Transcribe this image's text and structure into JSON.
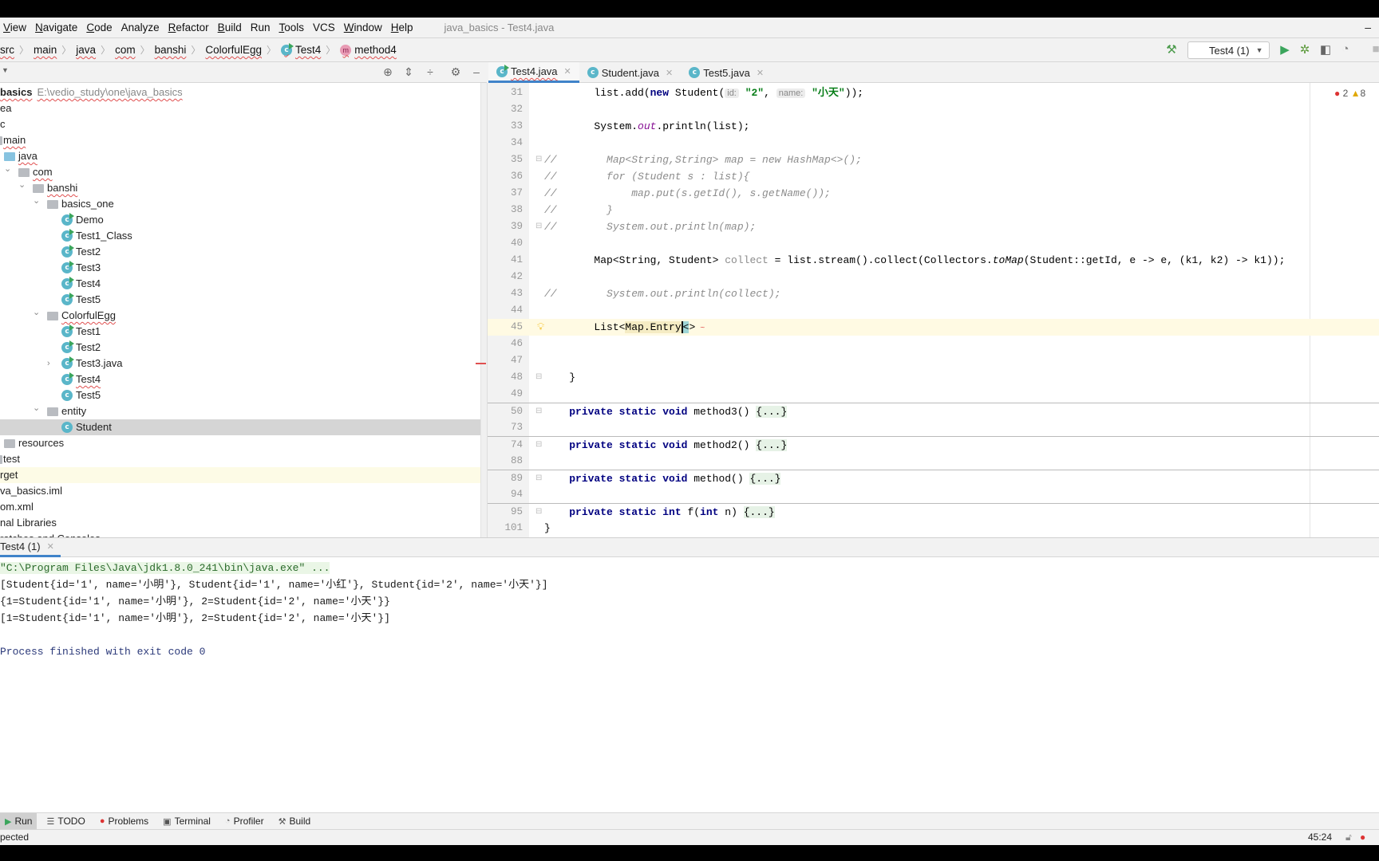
{
  "menu": {
    "items": [
      {
        "label": "View",
        "u": "V"
      },
      {
        "label": "Navigate",
        "u": "N"
      },
      {
        "label": "Code",
        "u": "C"
      },
      {
        "label": "Analyze",
        "u": ""
      },
      {
        "label": "Refactor",
        "u": "R"
      },
      {
        "label": "Build",
        "u": "B"
      },
      {
        "label": "Run",
        "u": ""
      },
      {
        "label": "Tools",
        "u": "T"
      },
      {
        "label": "VCS",
        "u": ""
      },
      {
        "label": "Window",
        "u": "W"
      },
      {
        "label": "Help",
        "u": "H"
      }
    ],
    "window_title": "java_basics - Test4.java",
    "minimize": "–"
  },
  "breadcrumb": [
    "src",
    "main",
    "java",
    "com",
    "banshi",
    "ColorfulEgg",
    "Test4",
    "method4"
  ],
  "toolbar": {
    "run_config": "Test4 (1)"
  },
  "project": {
    "rows": [
      {
        "label": "basics",
        "path": "E:\\vedio_study\\one\\java_basics",
        "depth": 0,
        "bold": true,
        "wavy": true
      },
      {
        "label": "ea",
        "depth": 0
      },
      {
        "label": "c",
        "depth": 0
      },
      {
        "label": "main",
        "depth": 0,
        "wavy": true,
        "stub": true
      },
      {
        "label": "java",
        "depth": 1,
        "icon": "src",
        "wavy": true
      },
      {
        "label": "com",
        "depth": 2,
        "icon": "package",
        "chev": "open",
        "wavy": true
      },
      {
        "label": "banshi",
        "depth": 3,
        "icon": "package",
        "chev": "open",
        "wavy": true
      },
      {
        "label": "basics_one",
        "depth": 4,
        "icon": "package",
        "chev": "open"
      },
      {
        "label": "Demo",
        "depth": 5,
        "icon": "class-run"
      },
      {
        "label": "Test1_Class",
        "depth": 5,
        "icon": "class-run"
      },
      {
        "label": "Test2",
        "depth": 5,
        "icon": "class-run"
      },
      {
        "label": "Test3",
        "depth": 5,
        "icon": "class-run"
      },
      {
        "label": "Test4",
        "depth": 5,
        "icon": "class-run"
      },
      {
        "label": "Test5",
        "depth": 5,
        "icon": "class-run"
      },
      {
        "label": "ColorfulEgg",
        "depth": 4,
        "icon": "package",
        "chev": "open",
        "wavy": true
      },
      {
        "label": "Test1",
        "depth": 5,
        "icon": "class-run"
      },
      {
        "label": "Test2",
        "depth": 5,
        "icon": "class-run"
      },
      {
        "label": "Test3.java",
        "depth": 5,
        "icon": "class-run",
        "chev": "closed"
      },
      {
        "label": "Test4",
        "depth": 5,
        "icon": "class-run",
        "wavy": true
      },
      {
        "label": "Test5",
        "depth": 5,
        "icon": "class"
      },
      {
        "label": "entity",
        "depth": 4,
        "icon": "package",
        "chev": "open"
      },
      {
        "label": "Student",
        "depth": 5,
        "icon": "class",
        "selected": true
      },
      {
        "label": "resources",
        "depth": 1,
        "icon": "resources"
      },
      {
        "label": "test",
        "depth": 0,
        "stub": true
      },
      {
        "label": "rget",
        "depth": 0,
        "highlight": true
      },
      {
        "label": "va_basics.iml",
        "depth": 0
      },
      {
        "label": "om.xml",
        "depth": 0
      },
      {
        "label": "nal Libraries",
        "depth": 0
      },
      {
        "label": "ratches and Consoles",
        "depth": 0
      }
    ]
  },
  "editor": {
    "tabs": [
      {
        "label": "Test4.java",
        "active": true,
        "icon": "class-run",
        "wavy": true
      },
      {
        "label": "Student.java",
        "icon": "class"
      },
      {
        "label": "Test5.java",
        "icon": "class"
      }
    ],
    "errors": "2",
    "warnings": "8",
    "lines": [
      {
        "n": "31",
        "t": [
          [
            "        list.add(",
            ""
          ],
          [
            "new",
            "kw"
          ],
          [
            " Student(",
            ""
          ],
          [
            "id:",
            "hint"
          ],
          [
            " ",
            ""
          ],
          [
            "\"2\"",
            "str"
          ],
          [
            ", ",
            ""
          ],
          [
            "name:",
            "hint"
          ],
          [
            " ",
            ""
          ],
          [
            "\"小天\"",
            "str"
          ],
          [
            "));",
            ""
          ]
        ]
      },
      {
        "n": "32",
        "t": []
      },
      {
        "n": "33",
        "t": [
          [
            "        System.",
            ""
          ],
          [
            "out",
            "fld"
          ],
          [
            ".println(list);",
            ""
          ]
        ]
      },
      {
        "n": "34",
        "t": []
      },
      {
        "n": "35",
        "fold": true,
        "t": [
          [
            "//        Map<String,String> map = new HashMap<>();",
            "cm"
          ]
        ]
      },
      {
        "n": "36",
        "t": [
          [
            "//        for (Student s : list){",
            "cm"
          ]
        ]
      },
      {
        "n": "37",
        "t": [
          [
            "//            map.put(s.getId(), s.getName());",
            "cm"
          ]
        ]
      },
      {
        "n": "38",
        "t": [
          [
            "//        }",
            "cm"
          ]
        ]
      },
      {
        "n": "39",
        "fold": true,
        "t": [
          [
            "//        System.out.println(map);",
            "cm"
          ]
        ]
      },
      {
        "n": "40",
        "t": []
      },
      {
        "n": "41",
        "t": [
          [
            "        Map<String, Student> ",
            ""
          ],
          [
            "collect",
            "unused"
          ],
          [
            " = list.stream().collect(Collectors.",
            ""
          ],
          [
            "toMap",
            "it"
          ],
          [
            "(Student::getId, e -> e, (k1, k2) -> k1));",
            ""
          ]
        ]
      },
      {
        "n": "42",
        "t": []
      },
      {
        "n": "43",
        "t": [
          [
            "//        System.out.println(collect);",
            "cm"
          ]
        ]
      },
      {
        "n": "44",
        "t": []
      },
      {
        "n": "45",
        "current": true,
        "bulb": true,
        "t": [
          [
            "        List<",
            ""
          ],
          [
            "Map.Entry",
            "hlw"
          ],
          [
            "<",
            "caret"
          ],
          [
            ">",
            ""
          ],
          [
            " ~",
            "squig"
          ]
        ]
      },
      {
        "n": "46",
        "t": []
      },
      {
        "n": "47",
        "t": []
      },
      {
        "n": "48",
        "fold": true,
        "t": [
          [
            "    }",
            ""
          ]
        ]
      },
      {
        "n": "49",
        "t": []
      },
      {
        "n": "50",
        "sep": true,
        "fold": true,
        "t": [
          [
            "    ",
            ""
          ],
          [
            "private static void",
            "kw"
          ],
          [
            " method3() ",
            ""
          ],
          [
            "{...}",
            "fold-txt"
          ]
        ]
      },
      {
        "n": "73",
        "t": []
      },
      {
        "n": "74",
        "sep": true,
        "fold": true,
        "t": [
          [
            "    ",
            ""
          ],
          [
            "private static void",
            "kw"
          ],
          [
            " method2() ",
            ""
          ],
          [
            "{...}",
            "fold-txt"
          ]
        ]
      },
      {
        "n": "88",
        "t": []
      },
      {
        "n": "89",
        "sep": true,
        "fold": true,
        "t": [
          [
            "    ",
            ""
          ],
          [
            "private static void",
            "kw"
          ],
          [
            " method() ",
            ""
          ],
          [
            "{...}",
            "fold-txt"
          ]
        ]
      },
      {
        "n": "94",
        "t": []
      },
      {
        "n": "95",
        "sep": true,
        "fold": true,
        "t": [
          [
            "    ",
            ""
          ],
          [
            "private static int",
            "kw"
          ],
          [
            " f(",
            ""
          ],
          [
            "int",
            "kw"
          ],
          [
            " n) ",
            ""
          ],
          [
            "{...}",
            "fold-txt"
          ]
        ]
      },
      {
        "n": "101",
        "t": [
          [
            "}",
            ""
          ]
        ]
      }
    ]
  },
  "run": {
    "tab": "Test4 (1)",
    "output": [
      "\"C:\\Program Files\\Java\\jdk1.8.0_241\\bin\\java.exe\" ...",
      "[Student{id='1', name='小明'}, Student{id='1', name='小红'}, Student{id='2', name='小天'}]",
      "{1=Student{id='1', name='小明'}, 2=Student{id='2', name='小天'}}",
      "[1=Student{id='1', name='小明'}, 2=Student{id='2', name='小天'}]",
      "",
      "Process finished with exit code 0"
    ]
  },
  "tool_tabs": [
    {
      "label": "Run",
      "icon": "run-icon",
      "selected": true
    },
    {
      "label": "TODO",
      "icon": "list-icon"
    },
    {
      "label": "Problems",
      "icon": "error-icon"
    },
    {
      "label": "Terminal",
      "icon": "terminal-icon"
    },
    {
      "label": "Profiler",
      "icon": "profiler-icon"
    },
    {
      "label": "Build",
      "icon": "hammer-icon"
    }
  ],
  "status": {
    "message": "pected",
    "position": "45:24"
  }
}
